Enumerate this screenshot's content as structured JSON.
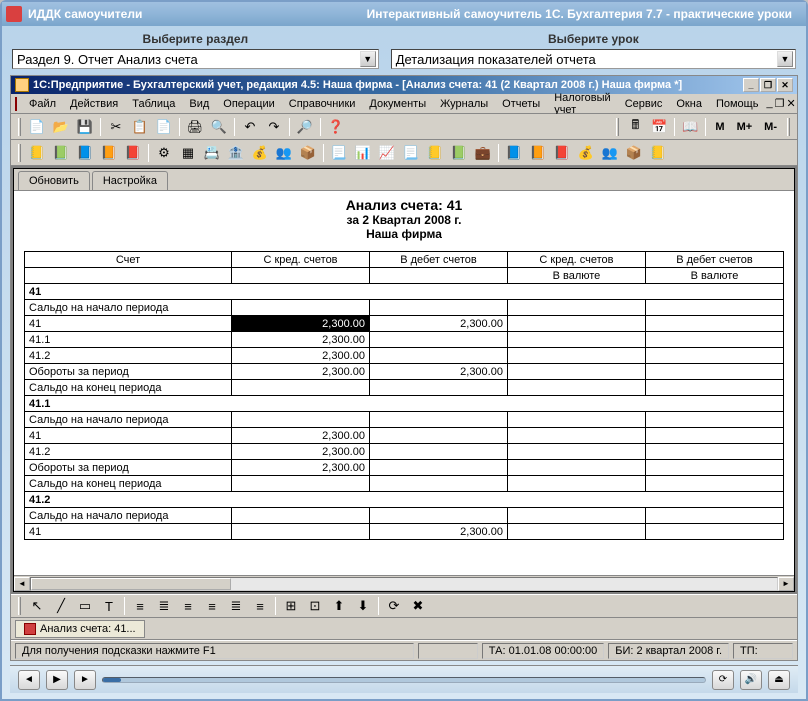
{
  "outer": {
    "app_name": "ИДДК самоучители",
    "app_title": "Интерактивный самоучитель 1С. Бухгалтерия 7.7 - практические уроки"
  },
  "selector": {
    "section_label": "Выберите раздел",
    "lesson_label": "Выберите урок",
    "section_value": "Раздел 9. Отчет Анализ счета",
    "lesson_value": "Детализация показателей отчета"
  },
  "inner": {
    "title": "1С:Предприятие - Бухгалтерский учет, редакция 4.5: Наша фирма - [Анализ счета: 41 (2 Квартал 2008 г.) Наша фирма  *]"
  },
  "menu": [
    "Файл",
    "Действия",
    "Таблица",
    "Вид",
    "Операции",
    "Справочники",
    "Документы",
    "Журналы",
    "Отчеты",
    "Налоговый учет",
    "Сервис",
    "Окна",
    "Помощь"
  ],
  "toolbar3_text": [
    "M",
    "M+",
    "M-"
  ],
  "doc_tabs": [
    "Обновить",
    "Настройка"
  ],
  "report": {
    "title": "Анализ счета: 41",
    "period": "за 2 Квартал 2008 г.",
    "firm": "Наша фирма",
    "columns": [
      "Счет",
      "С кред. счетов",
      "В дебет счетов",
      "С кред. счетов",
      "В дебет счетов"
    ],
    "sub_columns": [
      "",
      "",
      "",
      "В валюте",
      "В валюте"
    ]
  },
  "chart_data": {
    "type": "table",
    "columns": [
      "Счет",
      "С кред. счетов",
      "В дебет счетов",
      "С кред. счетов (В валюте)",
      "В дебет счетов (В валюте)"
    ],
    "sections": [
      {
        "header": "41",
        "rows": [
          {
            "label": "Сальдо на начало периода"
          },
          {
            "label": "41",
            "kred": "2,300.00",
            "deb": "2,300.00",
            "selected": true
          },
          {
            "label": "41.1",
            "kred": "2,300.00"
          },
          {
            "label": "41.2",
            "kred": "2,300.00"
          },
          {
            "label": "Обороты за период",
            "kred": "2,300.00",
            "deb": "2,300.00"
          },
          {
            "label": "Сальдо на конец периода"
          }
        ]
      },
      {
        "header": "41.1",
        "rows": [
          {
            "label": "Сальдо на начало периода"
          },
          {
            "label": "41",
            "kred": "2,300.00"
          },
          {
            "label": "41.2",
            "kred": "2,300.00"
          },
          {
            "label": "Обороты за период",
            "kred": "2,300.00"
          },
          {
            "label": "Сальдо на конец периода"
          }
        ]
      },
      {
        "header": "41.2",
        "rows": [
          {
            "label": "Сальдо на начало периода"
          },
          {
            "label": "41",
            "deb": "2,300.00"
          }
        ]
      }
    ]
  },
  "window_tab": "Анализ счета: 41...",
  "status": {
    "hint": "Для получения подсказки нажмите F1",
    "ta": "ТА: 01.01.08  00:00:00",
    "bi": "БИ: 2 квартал 2008 г.",
    "tp": "ТП:"
  },
  "icons": {
    "new": "📄",
    "open": "📂",
    "save": "💾",
    "cut": "✂",
    "copy": "📋",
    "paste": "📄",
    "print": "🖨",
    "preview": "🔍",
    "undo": "↶",
    "redo": "↷",
    "find": "🔎",
    "help": "❓",
    "calc": "🖩",
    "calendar": "📅",
    "book": "📖",
    "doc1": "📒",
    "doc2": "📗",
    "doc3": "📘",
    "doc4": "📙",
    "doc5": "📕",
    "grid": "▦",
    "chart": "📊",
    "graph": "📈",
    "ops": "⚙",
    "ref": "📇",
    "bank": "🏦",
    "money": "💰",
    "users": "👥",
    "goods": "📦",
    "report": "📃",
    "tax": "💼",
    "pointer": "↖",
    "line": "╱",
    "rect": "▭",
    "text": "T",
    "align-l": "≡",
    "align-c": "≣",
    "align-r": "≡",
    "grid2": "⊞",
    "snap": "⊡",
    "front": "⬆",
    "back": "⬇",
    "del": "✖",
    "rotate": "⟳"
  }
}
